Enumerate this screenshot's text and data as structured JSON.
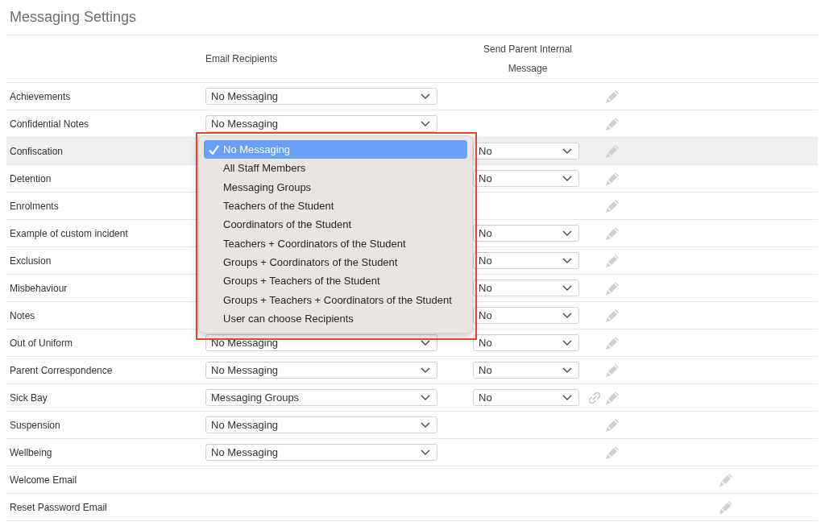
{
  "title": "Messaging Settings",
  "table": {
    "columns": [
      {
        "label": "Email Recipients"
      },
      {
        "label": "Send Parent Internal Message"
      }
    ],
    "rows": [
      {
        "label": "Achievements",
        "kind": "incident",
        "highlighted": false,
        "linked": false,
        "email_recipients": "No Messaging"
      },
      {
        "label": "Confidential Notes",
        "kind": "incident",
        "highlighted": false,
        "linked": false,
        "email_recipients": "No Messaging"
      },
      {
        "label": "Confiscation",
        "kind": "incident",
        "highlighted": true,
        "linked": false,
        "parent_message": "No",
        "menu": {
          "framed": true,
          "options": [
            {
              "label": "No Messaging",
              "selected": true
            },
            {
              "label": "All Staff Members",
              "selected": false
            },
            {
              "label": "Messaging Groups",
              "selected": false
            },
            {
              "label": "Teachers of the Student",
              "selected": false
            },
            {
              "label": "Coordinators of the Student",
              "selected": false
            },
            {
              "label": "Teachers + Coordinators of the Student",
              "selected": false
            },
            {
              "label": "Groups + Coordinators of the Student",
              "selected": false
            },
            {
              "label": "Groups + Teachers of the Student",
              "selected": false
            },
            {
              "label": "Groups + Teachers + Coordinators of the Student",
              "selected": false
            },
            {
              "label": "User can choose Recipients",
              "selected": false
            }
          ]
        }
      },
      {
        "label": "Detention",
        "kind": "incident",
        "highlighted": false,
        "linked": false,
        "parent_message": "No"
      },
      {
        "label": "Enrolments",
        "kind": "incident",
        "highlighted": false,
        "linked": false
      },
      {
        "label": "Example of custom incident",
        "kind": "incident",
        "highlighted": false,
        "linked": false,
        "parent_message": "No"
      },
      {
        "label": "Exclusion",
        "kind": "incident",
        "highlighted": false,
        "linked": false,
        "parent_message": "No"
      },
      {
        "label": "Misbehaviour",
        "kind": "incident",
        "highlighted": false,
        "linked": false,
        "parent_message": "No"
      },
      {
        "label": "Notes",
        "kind": "incident",
        "highlighted": false,
        "linked": false,
        "parent_message": "No"
      },
      {
        "label": "Out of Uniform",
        "kind": "incident",
        "highlighted": false,
        "linked": false,
        "email_recipients": "No Messaging",
        "parent_message": "No"
      },
      {
        "label": "Parent Correspondence",
        "kind": "incident",
        "highlighted": false,
        "linked": false,
        "email_recipients": "No Messaging",
        "parent_message": "No"
      },
      {
        "label": "Sick Bay",
        "kind": "incident",
        "highlighted": false,
        "linked": true,
        "email_recipients": "Messaging Groups",
        "parent_message": "No"
      },
      {
        "label": "Suspension",
        "kind": "incident",
        "highlighted": false,
        "linked": false,
        "email_recipients": "No Messaging"
      },
      {
        "label": "Wellbeing",
        "kind": "incident",
        "highlighted": false,
        "linked": false,
        "email_recipients": "No Messaging"
      },
      {
        "label": "Welcome Email",
        "kind": "template",
        "highlighted": false,
        "linked": false
      },
      {
        "label": "Reset Password Email",
        "kind": "template",
        "highlighted": false,
        "linked": false
      }
    ]
  }
}
